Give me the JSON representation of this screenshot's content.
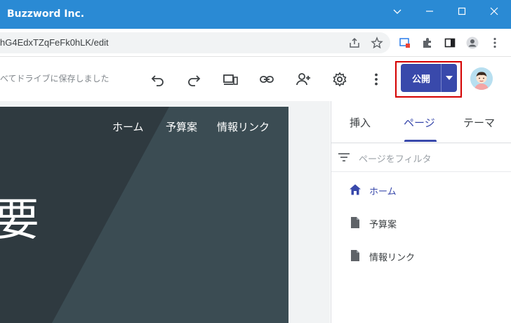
{
  "window": {
    "title": "Buzzword Inc."
  },
  "address_bar": {
    "url": "hG4EdxTZqFeFk0hLK/edit"
  },
  "toolbar": {
    "save_status": "べてドライブに保存しました",
    "publish_label": "公開"
  },
  "site": {
    "nav": [
      "ホーム",
      "予算案",
      "情報リンク"
    ],
    "hero_text": "要"
  },
  "panel": {
    "tabs": [
      {
        "label": "挿入",
        "active": false
      },
      {
        "label": "ページ",
        "active": true
      },
      {
        "label": "テーマ",
        "active": false
      }
    ],
    "filter_placeholder": "ページをフィルタ",
    "pages": [
      {
        "label": "ホーム",
        "icon": "home-icon",
        "active": true
      },
      {
        "label": "予算案",
        "icon": "page-icon",
        "active": false
      },
      {
        "label": "情報リンク",
        "icon": "page-icon",
        "active": false
      }
    ]
  },
  "colors": {
    "titlebar": "#2a8ad4",
    "accent": "#3949ab",
    "hero": "#37474f",
    "highlight_frame": "#d40000"
  }
}
